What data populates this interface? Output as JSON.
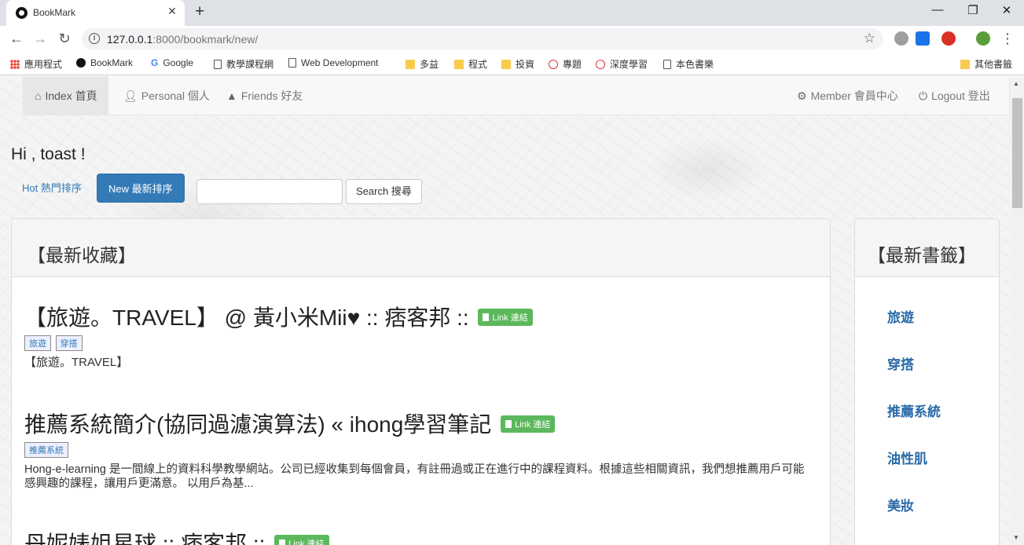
{
  "browser": {
    "tab_title": "BookMark",
    "tab_close": "✕",
    "new_tab": "+",
    "win_min": "—",
    "win_max": "❐",
    "win_close": "✕",
    "back": "←",
    "forward": "→",
    "reload": "↻",
    "url_host": "127.0.0.1",
    "url_rest": ":8000/bookmark/new/",
    "star": "☆",
    "menu": "⋮"
  },
  "bookmarks_bar": {
    "items": [
      {
        "label": "應用程式",
        "icon": "apps-icon"
      },
      {
        "label": "BookMark",
        "icon": "bookmark-site-icon"
      },
      {
        "label": "Google",
        "icon": "google-icon"
      },
      {
        "label": "教學課程網",
        "icon": "page-icon"
      },
      {
        "label": "Web Development",
        "icon": "devdocs-icon"
      },
      {
        "label": "多益",
        "icon": "folder-icon"
      },
      {
        "label": "程式",
        "icon": "folder-icon"
      },
      {
        "label": "投資",
        "icon": "folder-icon"
      },
      {
        "label": "專題",
        "icon": "site-icon"
      },
      {
        "label": "深度學習",
        "icon": "site-icon"
      },
      {
        "label": "本色書樂",
        "icon": "page-icon"
      }
    ],
    "other": "其他書籤"
  },
  "site_nav": {
    "index": "Index 首頁",
    "personal": "Personal 個人",
    "friends": "Friends 好友",
    "member": "Member 會員中心",
    "logout": "Logout 登出"
  },
  "greeting": "Hi , toast !",
  "buttons": {
    "hot": "Hot 熱門排序",
    "new": "New 最新排序",
    "search": "Search 搜尋"
  },
  "main_panel": {
    "heading": "【最新收藏】",
    "link_label": "Link 連結",
    "entries": [
      {
        "title": "【旅遊。TRAVEL】 @ 黃小米Mii♥ :: 痞客邦 ::",
        "tags": [
          "旅遊",
          "穿搭"
        ],
        "description": "【旅遊。TRAVEL】"
      },
      {
        "title": "推薦系統簡介(協同過濾演算法) « ihong學習筆記",
        "tags": [
          "推薦系統"
        ],
        "description": "Hong-e-learning 是一間線上的資料科學教學網站。公司已經收集到每個會員，有註冊過或正在進行中的課程資料。根據這些相關資訊，我們想推薦用戶可能感興趣的課程，讓用戶更滿意。 以用戶為基..."
      },
      {
        "title": "丹妮婊姐星球 :: 痞客邦 ::",
        "tags": [],
        "description": ""
      }
    ]
  },
  "side_panel": {
    "heading": "【最新書籤】",
    "links": [
      "旅遊",
      "穿搭",
      "推薦系統",
      "油性肌",
      "美妝"
    ]
  },
  "colors": {
    "primary": "#337ab7",
    "success": "#5cb85c",
    "nav_bg": "#f8f8f8"
  }
}
